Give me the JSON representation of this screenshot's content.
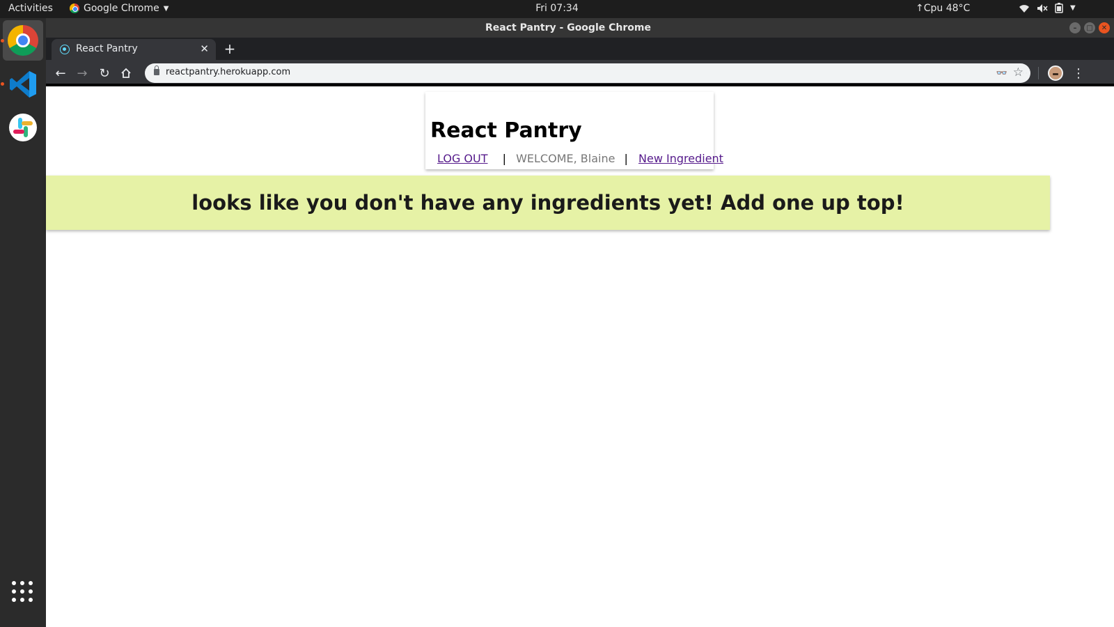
{
  "topbar": {
    "activities": "Activities",
    "app_name": "Google Chrome",
    "clock": "Fri 07:34",
    "cpu": "↑Cpu 48°C"
  },
  "window": {
    "title": "React Pantry - Google Chrome"
  },
  "tabs": [
    {
      "label": "React Pantry"
    }
  ],
  "omnibox": {
    "url": "reactpantry.herokuapp.com"
  },
  "page": {
    "title": "React Pantry",
    "nav": {
      "logout": "LOG OUT",
      "separator": "|",
      "welcome": "WELCOME, Blaine",
      "new_ingredient": "New Ingredient"
    },
    "empty_message": "looks like you don't have any ingredients yet! Add one up top!"
  },
  "colors": {
    "banner_bg": "#e6f2a6",
    "link": "#551a8b",
    "ubuntu_orange": "#e95420"
  }
}
